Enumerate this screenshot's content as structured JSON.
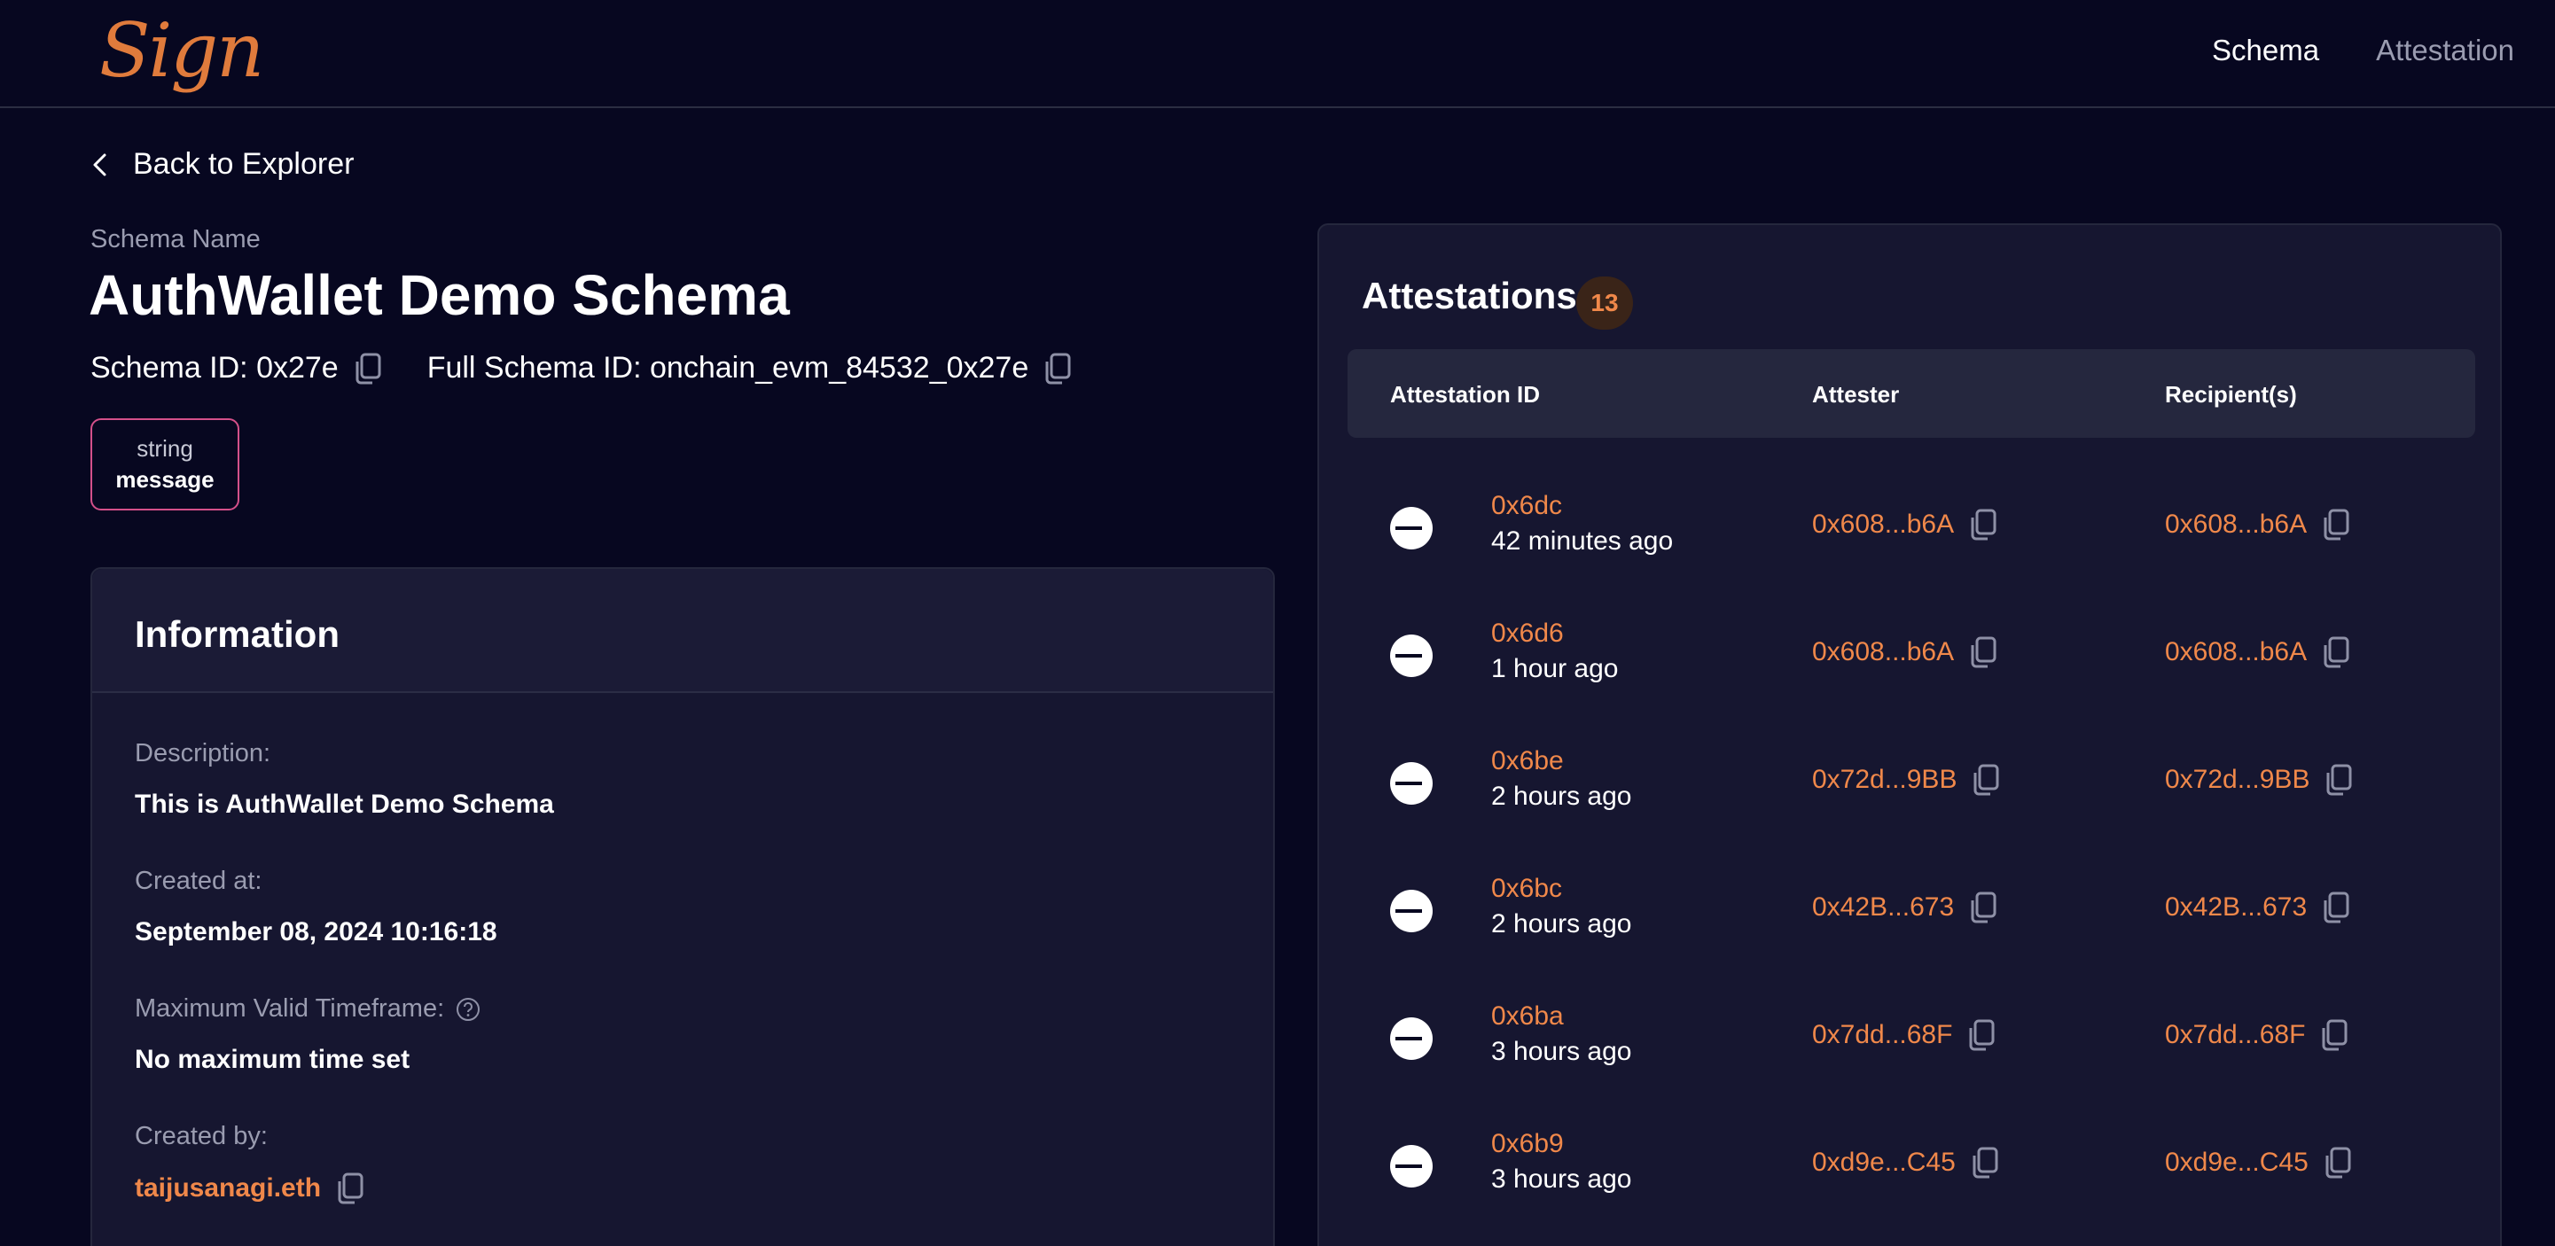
{
  "header": {
    "logo": "Sign",
    "nav": [
      {
        "label": "Schema",
        "active": true
      },
      {
        "label": "Attestation",
        "active": false
      }
    ]
  },
  "back_link": "Back to Explorer",
  "schema": {
    "name_label": "Schema Name",
    "name": "AuthWallet Demo Schema",
    "schema_id": "Schema ID: 0x27e",
    "full_schema_id": "Full Schema ID: onchain_evm_84532_0x27e",
    "fields": [
      {
        "type": "string",
        "name": "message"
      }
    ]
  },
  "information": {
    "title": "Information",
    "description_label": "Description:",
    "description": "This is AuthWallet Demo Schema",
    "created_at_label": "Created at:",
    "created_at": "September 08, 2024 10:16:18",
    "max_timeframe_label": "Maximum Valid Timeframe:",
    "max_timeframe": "No maximum time set",
    "created_by_label": "Created by:",
    "created_by": "taijusanagi.eth"
  },
  "attestations": {
    "title": "Attestations",
    "count": "13",
    "columns": [
      "Attestation ID",
      "Attester",
      "Recipient(s)"
    ],
    "rows": [
      {
        "id": "0x6dc",
        "time": "42 minutes ago",
        "attester": "0x608...b6A",
        "recipient": "0x608...b6A"
      },
      {
        "id": "0x6d6",
        "time": "1 hour ago",
        "attester": "0x608...b6A",
        "recipient": "0x608...b6A"
      },
      {
        "id": "0x6be",
        "time": "2 hours ago",
        "attester": "0x72d...9BB",
        "recipient": "0x72d...9BB"
      },
      {
        "id": "0x6bc",
        "time": "2 hours ago",
        "attester": "0x42B...673",
        "recipient": "0x42B...673"
      },
      {
        "id": "0x6ba",
        "time": "3 hours ago",
        "attester": "0x7dd...68F",
        "recipient": "0x7dd...68F"
      },
      {
        "id": "0x6b9",
        "time": "3 hours ago",
        "attester": "0xd9e...C45",
        "recipient": "0xd9e...C45"
      }
    ]
  },
  "colors": {
    "background": "#070720",
    "accent": "#f0884a",
    "card": "#161630"
  },
  "icons": {
    "back": "chevron-left-icon",
    "copy": "copy-icon",
    "help": "question-circle-icon",
    "status": "revoke-status-icon"
  }
}
